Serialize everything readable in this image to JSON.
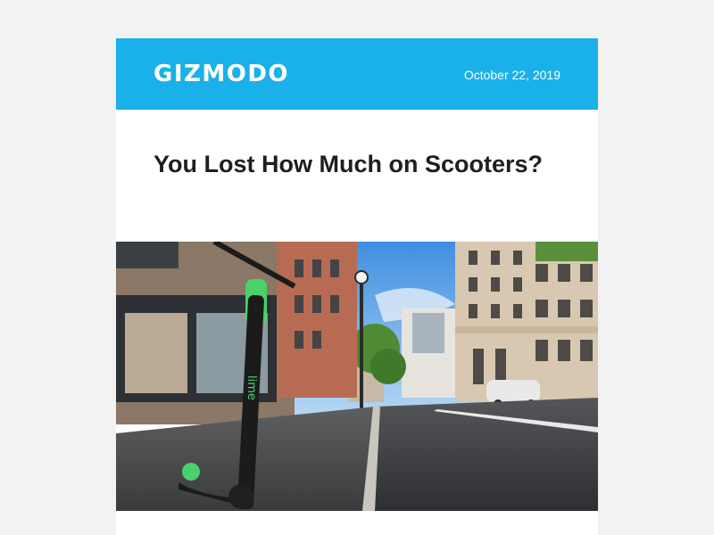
{
  "header": {
    "logo": "GIZMODO",
    "date": "October 22, 2019",
    "background_color": "#1ab0ea"
  },
  "article": {
    "title": "You Lost How Much on Scooters?"
  },
  "hero_image": {
    "scooter_brand": "lime"
  }
}
